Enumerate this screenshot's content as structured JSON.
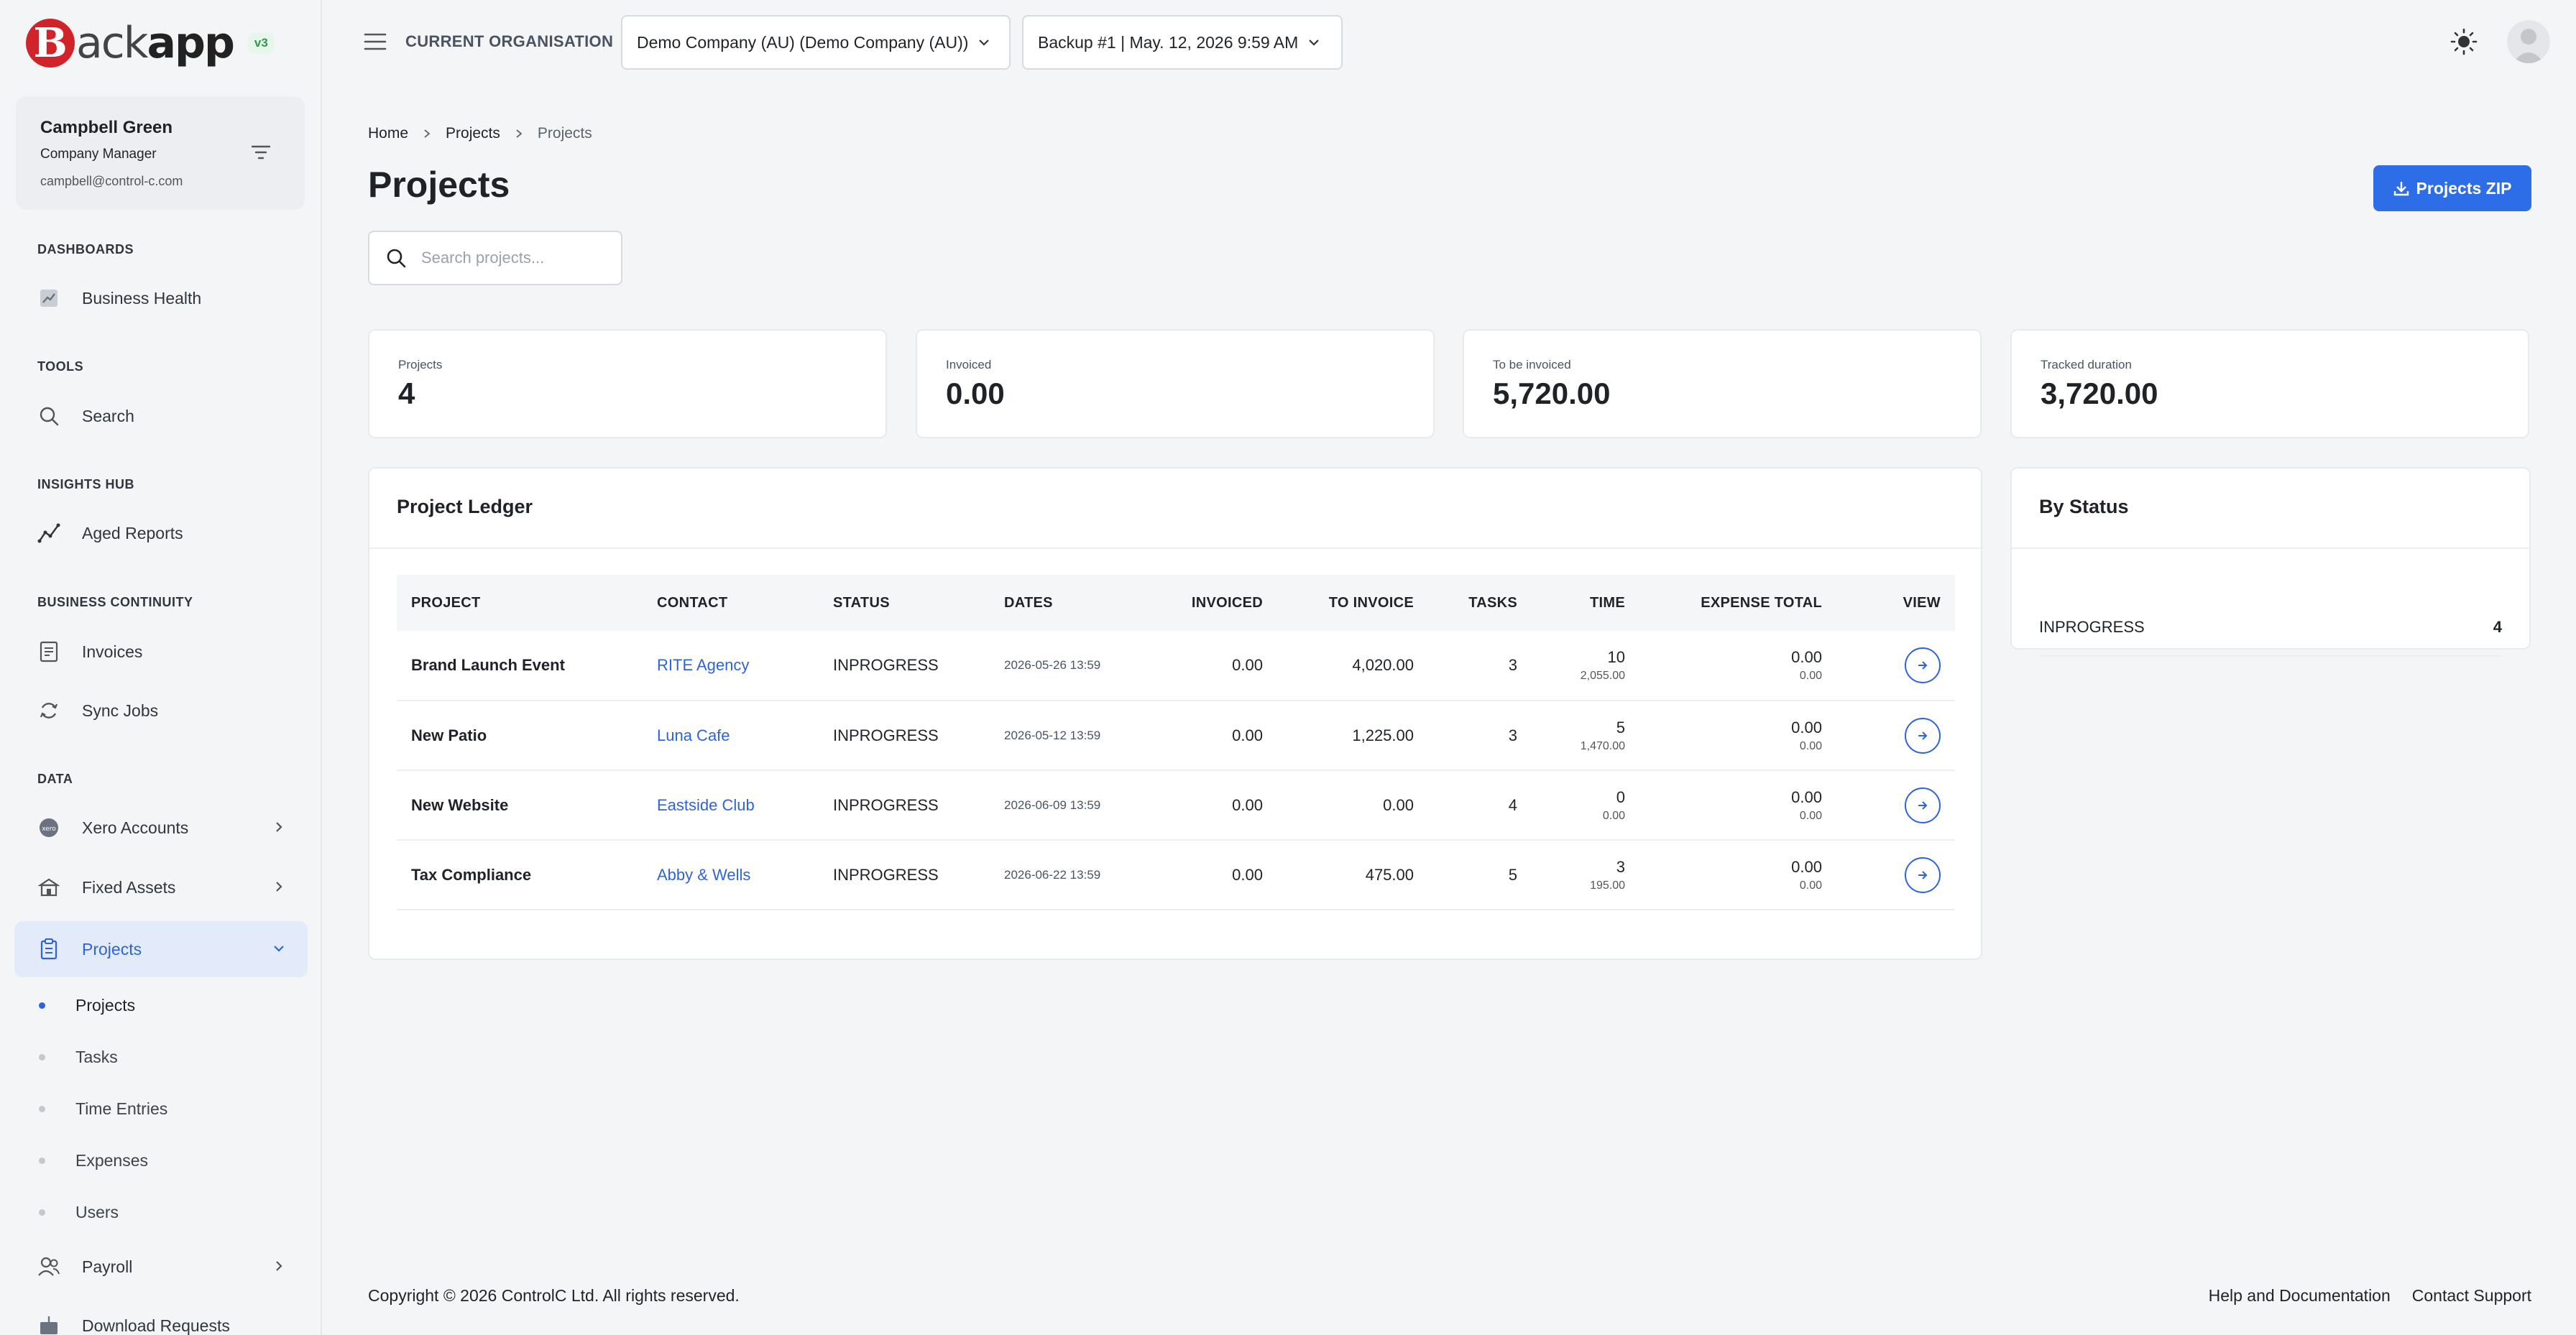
{
  "brand": {
    "logo_letter": "B",
    "logo_ack": "ack",
    "logo_app": "app",
    "version": "v3",
    "accent": "#2d6ee8",
    "logo_color": "#d1232a"
  },
  "user": {
    "name": "Campbell Green",
    "role": "Company Manager",
    "email": "campbell@control-c.com"
  },
  "sidebar": {
    "sections": {
      "dashboards": "DASHBOARDS",
      "tools": "TOOLS",
      "insights": "INSIGHTS HUB",
      "continuity": "BUSINESS CONTINUITY",
      "data": "DATA"
    },
    "items": {
      "business_health": "Business Health",
      "search": "Search",
      "aged_reports": "Aged Reports",
      "invoices": "Invoices",
      "sync_jobs": "Sync Jobs",
      "xero_accounts": "Xero Accounts",
      "fixed_assets": "Fixed Assets",
      "projects": "Projects",
      "payroll": "Payroll",
      "download_requests": "Download Requests"
    },
    "project_sub": {
      "projects": "Projects",
      "tasks": "Tasks",
      "time_entries": "Time Entries",
      "expenses": "Expenses",
      "users": "Users"
    }
  },
  "header": {
    "org_label": "CURRENT ORGANISATION",
    "org_value": "Demo Company (AU) (Demo Company (AU))",
    "backup_value": "Backup #1 | May. 12, 2026 9:59 AM"
  },
  "breadcrumb": [
    "Home",
    "Projects",
    "Projects"
  ],
  "page": {
    "title": "Projects",
    "zip_button": "Projects ZIP",
    "search_placeholder": "Search projects..."
  },
  "stats": [
    {
      "label": "Projects",
      "value": "4"
    },
    {
      "label": "Invoiced",
      "value": "0.00"
    },
    {
      "label": "To be invoiced",
      "value": "5,720.00"
    },
    {
      "label": "Tracked duration",
      "value": "3,720.00"
    }
  ],
  "ledger": {
    "title": "Project Ledger",
    "columns": {
      "project": "PROJECT",
      "contact": "CONTACT",
      "status": "STATUS",
      "dates": "DATES",
      "invoiced": "INVOICED",
      "to_invoice": "TO INVOICE",
      "tasks": "TASKS",
      "time": "TIME",
      "expense_total": "EXPENSE TOTAL",
      "view": "VIEW"
    },
    "rows": [
      {
        "project": "Brand Launch Event",
        "contact": "RITE Agency",
        "status": "INPROGRESS",
        "dates": "2026-05-26 13:59",
        "invoiced": "0.00",
        "to_invoice": "4,020.00",
        "tasks": "3",
        "time": "10",
        "time_sub": "2,055.00",
        "expense": "0.00",
        "expense_sub": "0.00"
      },
      {
        "project": "New Patio",
        "contact": "Luna Cafe",
        "status": "INPROGRESS",
        "dates": "2026-05-12 13:59",
        "invoiced": "0.00",
        "to_invoice": "1,225.00",
        "tasks": "3",
        "time": "5",
        "time_sub": "1,470.00",
        "expense": "0.00",
        "expense_sub": "0.00"
      },
      {
        "project": "New Website",
        "contact": "Eastside Club",
        "status": "INPROGRESS",
        "dates": "2026-06-09 13:59",
        "invoiced": "0.00",
        "to_invoice": "0.00",
        "tasks": "4",
        "time": "0",
        "time_sub": "0.00",
        "expense": "0.00",
        "expense_sub": "0.00"
      },
      {
        "project": "Tax Compliance",
        "contact": "Abby & Wells",
        "status": "INPROGRESS",
        "dates": "2026-06-22 13:59",
        "invoiced": "0.00",
        "to_invoice": "475.00",
        "tasks": "5",
        "time": "3",
        "time_sub": "195.00",
        "expense": "0.00",
        "expense_sub": "0.00"
      }
    ]
  },
  "by_status": {
    "title": "By Status",
    "rows": [
      {
        "status": "INPROGRESS",
        "count": "4"
      }
    ]
  },
  "footer": {
    "copyright": "Copyright © 2026 ControlC Ltd. All rights reserved.",
    "help": "Help and Documentation",
    "support": "Contact Support"
  }
}
